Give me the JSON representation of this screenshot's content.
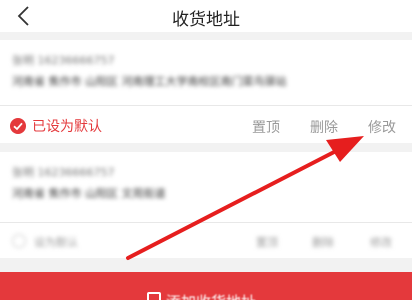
{
  "header": {
    "title": "收货地址"
  },
  "address1": {
    "name_phone": "张明   16236666757",
    "address": "河南省 焦作市 山阳区 河南理工大学南校区南门菜鸟驿站",
    "default_label": "已设为默认",
    "actions": {
      "top": "置顶",
      "delete": "删除",
      "edit": "修改"
    }
  },
  "address2": {
    "name_phone": "张明   16236666757",
    "address": "河南省 焦作市 山阳区 文苑街道",
    "set_default_label": "设为默认",
    "actions": {
      "top": "置顶",
      "delete": "删除",
      "edit": "修改"
    }
  },
  "bottom": {
    "add_label": "添加收货地址"
  },
  "colors": {
    "accent": "#e4393c"
  }
}
